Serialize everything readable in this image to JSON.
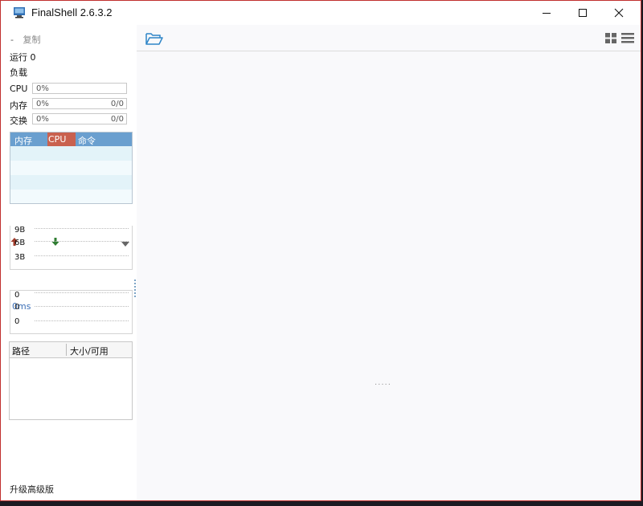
{
  "window": {
    "title": "FinalShell 2.6.3.2"
  },
  "sidebar": {
    "copy_dash": "-",
    "copy_label": "复制",
    "running": "运行 0",
    "load": "负载",
    "cpu": {
      "label": "CPU",
      "value": "0%"
    },
    "memory": {
      "label": "内存",
      "value": "0%",
      "ratio": "0/0"
    },
    "swap": {
      "label": "交换",
      "value": "0%",
      "ratio": "0/0"
    },
    "process_table": {
      "headers": [
        "内存",
        "CPU",
        "命令"
      ]
    },
    "network": {
      "y_labels": [
        "9B",
        "6B",
        "3B"
      ]
    },
    "latency": {
      "label": "0ms",
      "y_labels": [
        "0",
        "0",
        "0"
      ]
    },
    "files_table": {
      "headers": [
        "路径",
        "大小/可用"
      ]
    },
    "upgrade": "升级高级版"
  },
  "main": {
    "loading": "....."
  },
  "colors": {
    "accent": "#6a9fcf",
    "cpu_header": "#c9614f",
    "upload": "#a03b2a",
    "download": "#2f7d32",
    "border": "#c0302f"
  }
}
